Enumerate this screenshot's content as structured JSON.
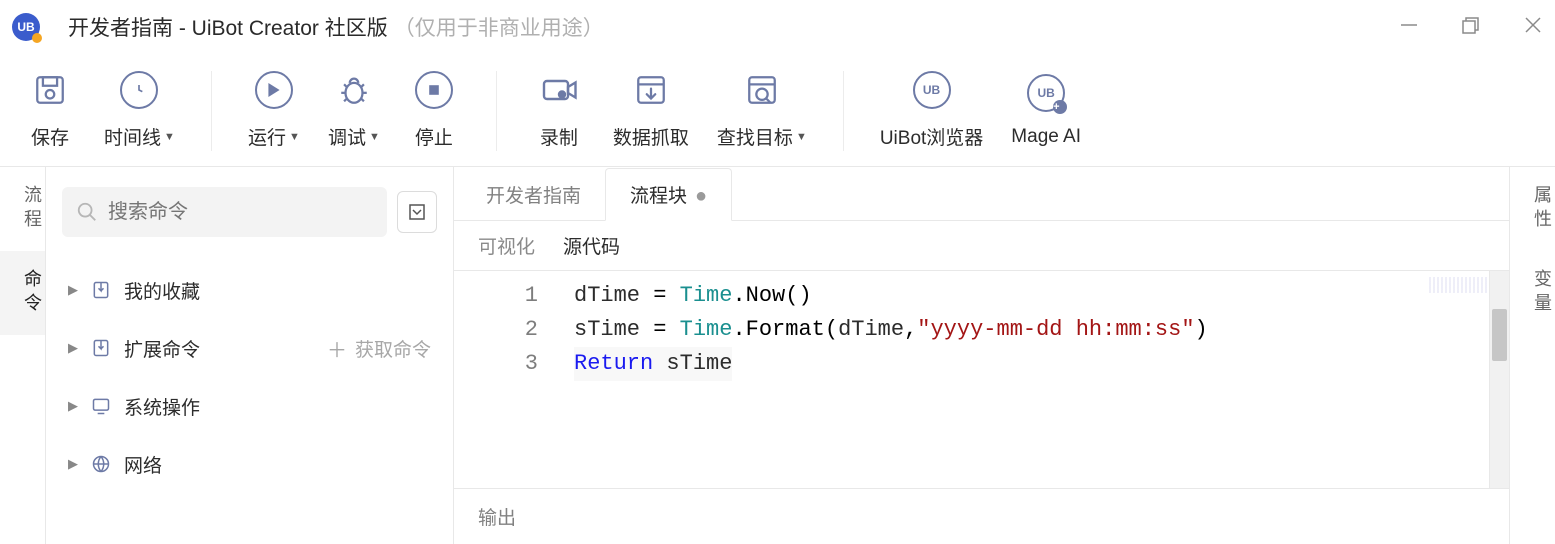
{
  "titlebar": {
    "logo_text": "UB",
    "title": "开发者指南 - UiBot Creator 社区版",
    "subtitle": "（仅用于非商业用途）"
  },
  "toolbar": {
    "save": "保存",
    "timeline": "时间线",
    "run": "运行",
    "debug": "调试",
    "stop": "停止",
    "record": "录制",
    "data_grab": "数据抓取",
    "find_target": "查找目标",
    "browser": "UiBot浏览器",
    "mage": "Mage AI"
  },
  "left_tabs": {
    "flow": "流程",
    "commands": "命令"
  },
  "right_tabs": {
    "props": "属性",
    "vars": "变量"
  },
  "command_panel": {
    "search_placeholder": "搜索命令",
    "items": [
      "我的收藏",
      "扩展命令",
      "系统操作",
      "网络"
    ],
    "get_commands": "获取命令"
  },
  "editor": {
    "tabs": [
      {
        "label": "开发者指南",
        "active": false,
        "dirty": false
      },
      {
        "label": "流程块",
        "active": true,
        "dirty": true
      }
    ],
    "view_tabs": {
      "visual": "可视化",
      "source": "源代码",
      "active": "source"
    },
    "code_lines": [
      {
        "n": "1",
        "tokens": [
          [
            "",
            "dTime "
          ],
          [
            "op",
            "="
          ],
          [
            "",
            " "
          ],
          [
            "cls",
            "Time"
          ],
          [
            "op",
            "."
          ],
          [
            "fn",
            "Now"
          ],
          [
            "op",
            "()"
          ]
        ]
      },
      {
        "n": "2",
        "tokens": [
          [
            "",
            "sTime "
          ],
          [
            "op",
            "="
          ],
          [
            "",
            " "
          ],
          [
            "cls",
            "Time"
          ],
          [
            "op",
            "."
          ],
          [
            "fn",
            "Format"
          ],
          [
            "op",
            "("
          ],
          [
            "",
            "dTime"
          ],
          [
            "op",
            ","
          ],
          [
            "str",
            "\"yyyy-mm-dd hh:mm:ss\""
          ],
          [
            "op",
            ")"
          ]
        ]
      },
      {
        "n": "3",
        "tokens": [
          [
            "kw",
            "Return"
          ],
          [
            "",
            " sTime"
          ]
        ]
      }
    ],
    "output_label": "输出"
  }
}
